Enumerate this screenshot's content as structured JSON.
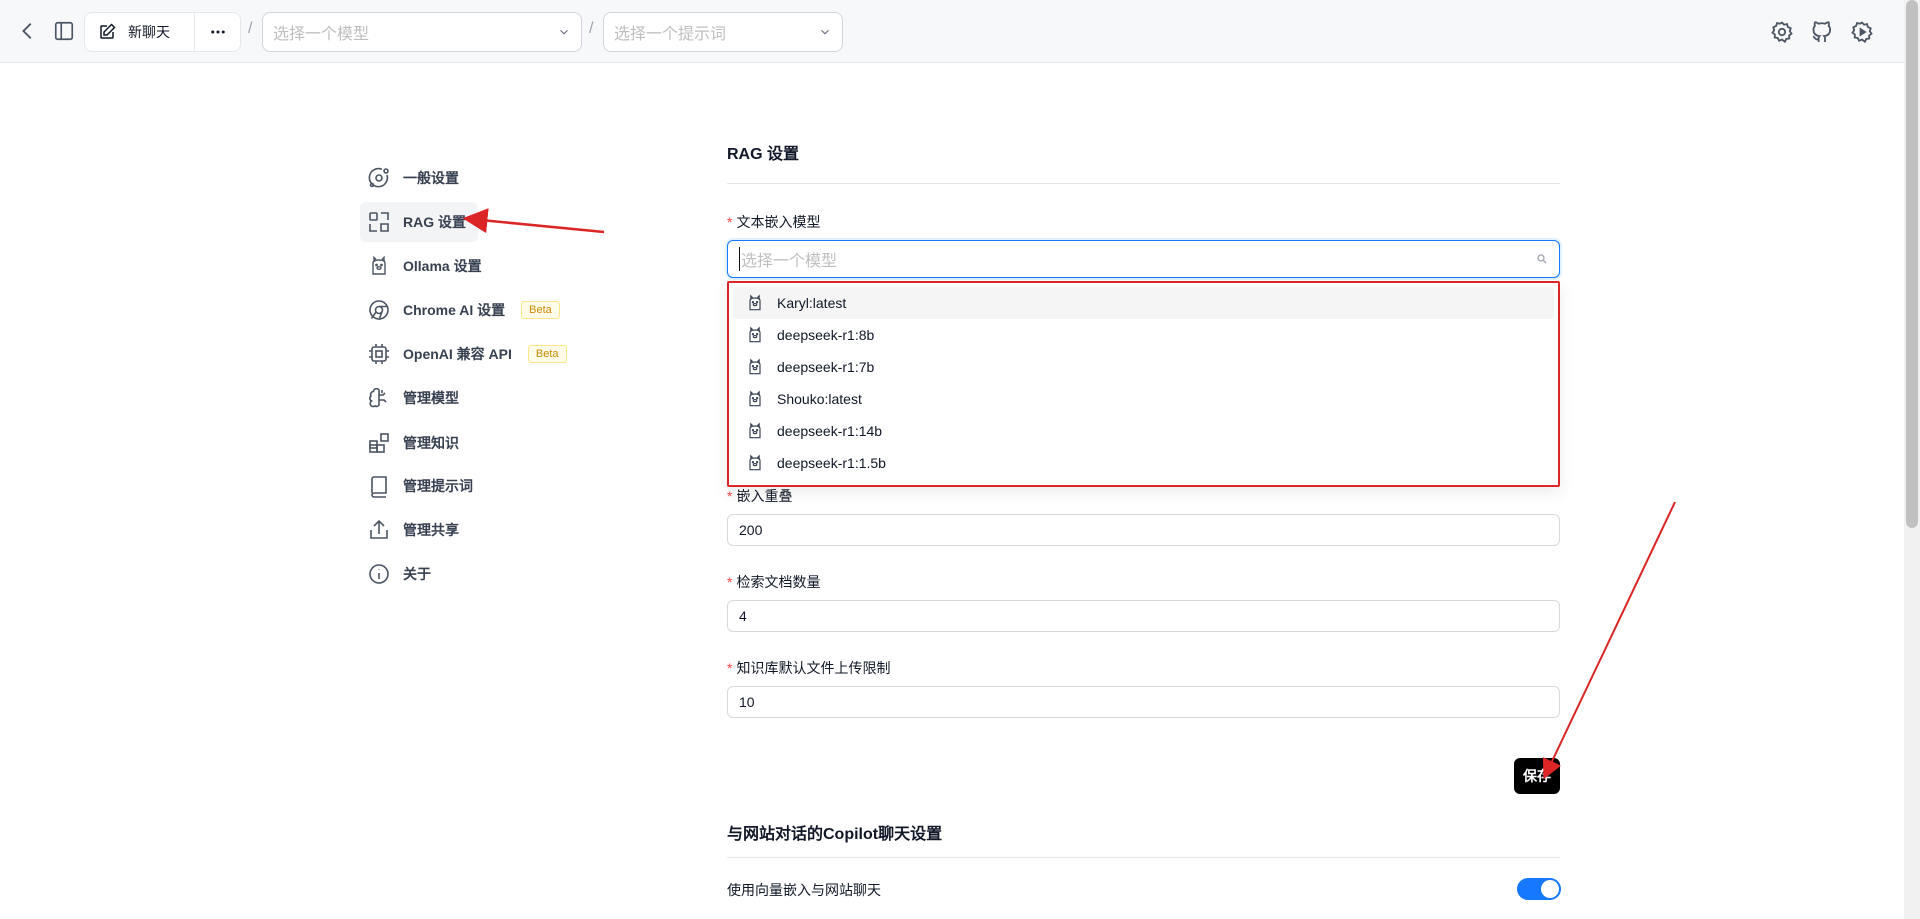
{
  "topbar": {
    "new_chat_label": "新聊天",
    "model_select_placeholder": "选择一个模型",
    "prompt_select_placeholder": "选择一个提示词",
    "separator": "/"
  },
  "nav": {
    "items": [
      {
        "label": "一般设置",
        "icon": "gear-icon",
        "beta": ""
      },
      {
        "label": "RAG 设置",
        "icon": "rag-icon",
        "beta": ""
      },
      {
        "label": "Ollama 设置",
        "icon": "llama-icon",
        "beta": ""
      },
      {
        "label": "Chrome AI 设置",
        "icon": "chrome-icon",
        "beta": "Beta"
      },
      {
        "label": "OpenAI 兼容 API",
        "icon": "cpu-icon",
        "beta": "Beta"
      },
      {
        "label": "管理模型",
        "icon": "brain-icon",
        "beta": ""
      },
      {
        "label": "管理知识",
        "icon": "blocks-icon",
        "beta": ""
      },
      {
        "label": "管理提示词",
        "icon": "book-icon",
        "beta": ""
      },
      {
        "label": "管理共享",
        "icon": "share-icon",
        "beta": ""
      },
      {
        "label": "关于",
        "icon": "info-icon",
        "beta": ""
      }
    ],
    "active_index": 1
  },
  "rag": {
    "title": "RAG 设置",
    "embedding_model_label": "文本嵌入模型",
    "embedding_model_placeholder": "选择一个模型",
    "model_options": [
      "Karyl:latest",
      "deepseek-r1:8b",
      "deepseek-r1:7b",
      "Shouko:latest",
      "deepseek-r1:14b",
      "deepseek-r1:1.5b"
    ],
    "chunk_overlap_label": "嵌入重叠",
    "chunk_overlap_value": "200",
    "retrieval_count_label": "检索文档数量",
    "retrieval_count_value": "4",
    "upload_limit_label": "知识库默认文件上传限制",
    "upload_limit_value": "10",
    "save_label": "保存"
  },
  "copilot": {
    "title": "与网站对话的Copilot聊天设置",
    "vector_embedding_label": "使用向量嵌入与网站聊天",
    "vector_embedding_enabled": true
  },
  "colors": {
    "accent": "#1677ff",
    "annotation": "#dc2626",
    "required": "#ef4444"
  }
}
